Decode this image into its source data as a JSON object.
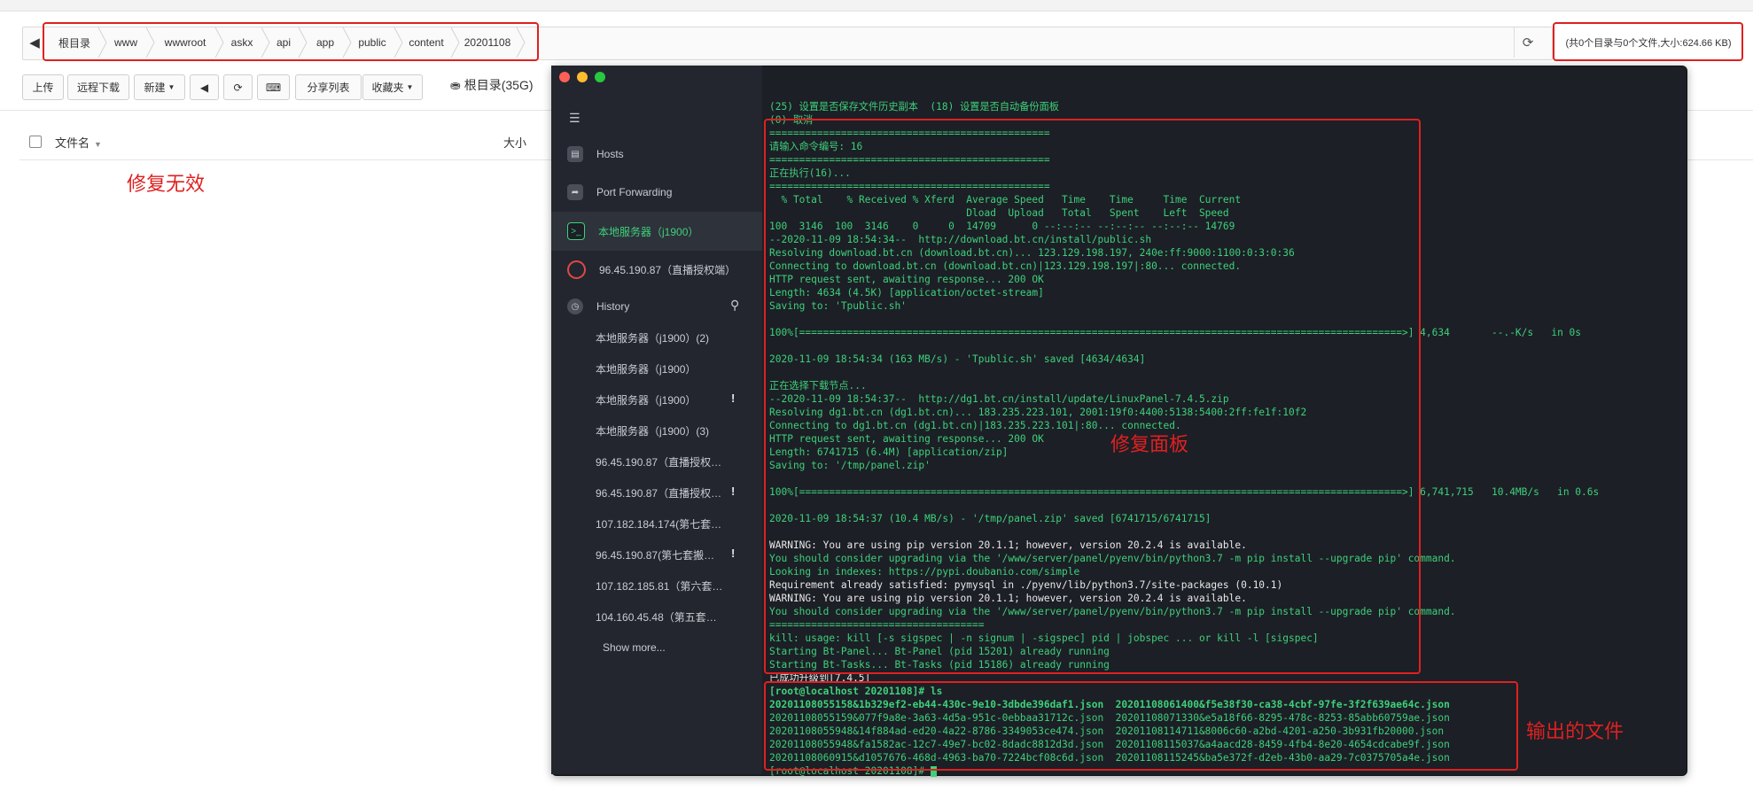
{
  "breadcrumb": {
    "items": [
      "根目录",
      "www",
      "wwwroot",
      "askx",
      "api",
      "app",
      "public",
      "content",
      "20201108"
    ],
    "summary": "(共0个目录与0个文件,大小:624.66 KB)"
  },
  "toolbar": {
    "upload": "上传",
    "remote_download": "远程下载",
    "new": "新建",
    "share_list": "分享列表",
    "favorites": "收藏夹",
    "disk": "根目录(35G)"
  },
  "table": {
    "col_name": "文件名",
    "col_size": "大小"
  },
  "annotations": {
    "fix_invalid": "修复无效",
    "fix_panel": "修复面板",
    "output_files": "输出的文件"
  },
  "terminal": {
    "sidebar": {
      "hosts": "Hosts",
      "port_forwarding": "Port Forwarding",
      "local_server": "本地服务器（j1900）",
      "remote_server": "96.45.190.87（直播授权端）",
      "history": "History",
      "history_items": [
        "本地服务器（j1900）(2)",
        "本地服务器（j1900）",
        "本地服务器（j1900）",
        "本地服务器（j1900）(3)",
        "96.45.190.87（直播授权…",
        "96.45.190.87（直播授权…",
        "107.182.184.174(第七套搬…",
        "96.45.190.87(第七套搬…",
        "107.182.185.81（第六套…",
        "104.160.45.48（第五套…"
      ],
      "show_more": "Show more..."
    },
    "lines": [
      "",
      "(25) 设置是否保存文件历史副本  (18) 设置是否自动备份面板",
      "(0) 取消",
      "===============================================",
      "请输入命令编号: 16",
      "===============================================",
      "正在执行(16)...",
      "===============================================",
      "  % Total    % Received % Xferd  Average Speed   Time    Time     Time  Current",
      "                                 Dload  Upload   Total   Spent    Left  Speed",
      "100  3146  100  3146    0     0  14709      0 --:--:-- --:--:-- --:--:-- 14769",
      "--2020-11-09 18:54:34--  http://download.bt.cn/install/public.sh",
      "Resolving download.bt.cn (download.bt.cn)... 123.129.198.197, 240e:ff:9000:1100:0:3:0:36",
      "Connecting to download.bt.cn (download.bt.cn)|123.129.198.197|:80... connected.",
      "HTTP request sent, awaiting response... 200 OK",
      "Length: 4634 (4.5K) [application/octet-stream]",
      "Saving to: 'Tpublic.sh'",
      "",
      "100%[=====================================================================================================>] 4,634       --.-K/s   in 0s",
      "",
      "2020-11-09 18:54:34 (163 MB/s) - 'Tpublic.sh' saved [4634/4634]",
      "",
      "正在选择下载节点...",
      "--2020-11-09 18:54:37--  http://dg1.bt.cn/install/update/LinuxPanel-7.4.5.zip",
      "Resolving dg1.bt.cn (dg1.bt.cn)... 183.235.223.101, 2001:19f0:4400:5138:5400:2ff:fe1f:10f2",
      "Connecting to dg1.bt.cn (dg1.bt.cn)|183.235.223.101|:80... connected.",
      "HTTP request sent, awaiting response... 200 OK",
      "Length: 6741715 (6.4M) [application/zip]",
      "Saving to: '/tmp/panel.zip'",
      "",
      "100%[=====================================================================================================>] 6,741,715   10.4MB/s   in 0.6s",
      "",
      "2020-11-09 18:54:37 (10.4 MB/s) - '/tmp/panel.zip' saved [6741715/6741715]",
      "",
      "WARNING: You are using pip version 20.1.1; however, version 20.2.4 is available.",
      "You should consider upgrading via the '/www/server/panel/pyenv/bin/python3.7 -m pip install --upgrade pip' command.",
      "Looking in indexes: https://pypi.doubanio.com/simple",
      "Requirement already satisfied: pymysql in ./pyenv/lib/python3.7/site-packages (0.10.1)",
      "WARNING: You are using pip version 20.1.1; however, version 20.2.4 is available.",
      "You should consider upgrading via the '/www/server/panel/pyenv/bin/python3.7 -m pip install --upgrade pip' command.",
      "====================================",
      "kill: usage: kill [-s sigspec | -n signum | -sigspec] pid | jobspec ... or kill -l [sigspec]",
      "Starting Bt-Panel... Bt-Panel (pid 15201) already running",
      "Starting Bt-Tasks... Bt-Tasks (pid 15186) already running",
      "已成功升级到[7.4.5]",
      "[root@localhost 20201108]# ls",
      "20201108055158&1b329ef2-eb44-430c-9e10-3dbde396daf1.json  20201108061400&f5e38f30-ca38-4cbf-97fe-3f2f639ae64c.json",
      "20201108055159&077f9a8e-3a63-4d5a-951c-0ebbaa31712c.json  20201108071330&e5a18f66-8295-478c-8253-85abb60759ae.json",
      "20201108055948&14f884ad-ed20-4a22-8786-3349053ce474.json  20201108114711&8006c60-a2bd-4201-a250-3b931fb20000.json",
      "20201108055948&fa1582ac-12c7-49e7-bc02-8dadc8812d3d.json  20201108115037&a4aacd28-8459-4fb4-8e20-4654cdcabe9f.json",
      "20201108060915&d1057676-468d-4963-ba70-7224bcf08c6d.json  20201108115245&ba5e372f-d2eb-43b0-aa29-7c0375705a4e.json",
      "[root@localhost 20201108]# "
    ]
  },
  "colors": {
    "annotation_red": "#e02020",
    "terminal_green": "#3ed07a",
    "terminal_bg": "#1c1f26",
    "sidebar_bg": "#23262e"
  }
}
